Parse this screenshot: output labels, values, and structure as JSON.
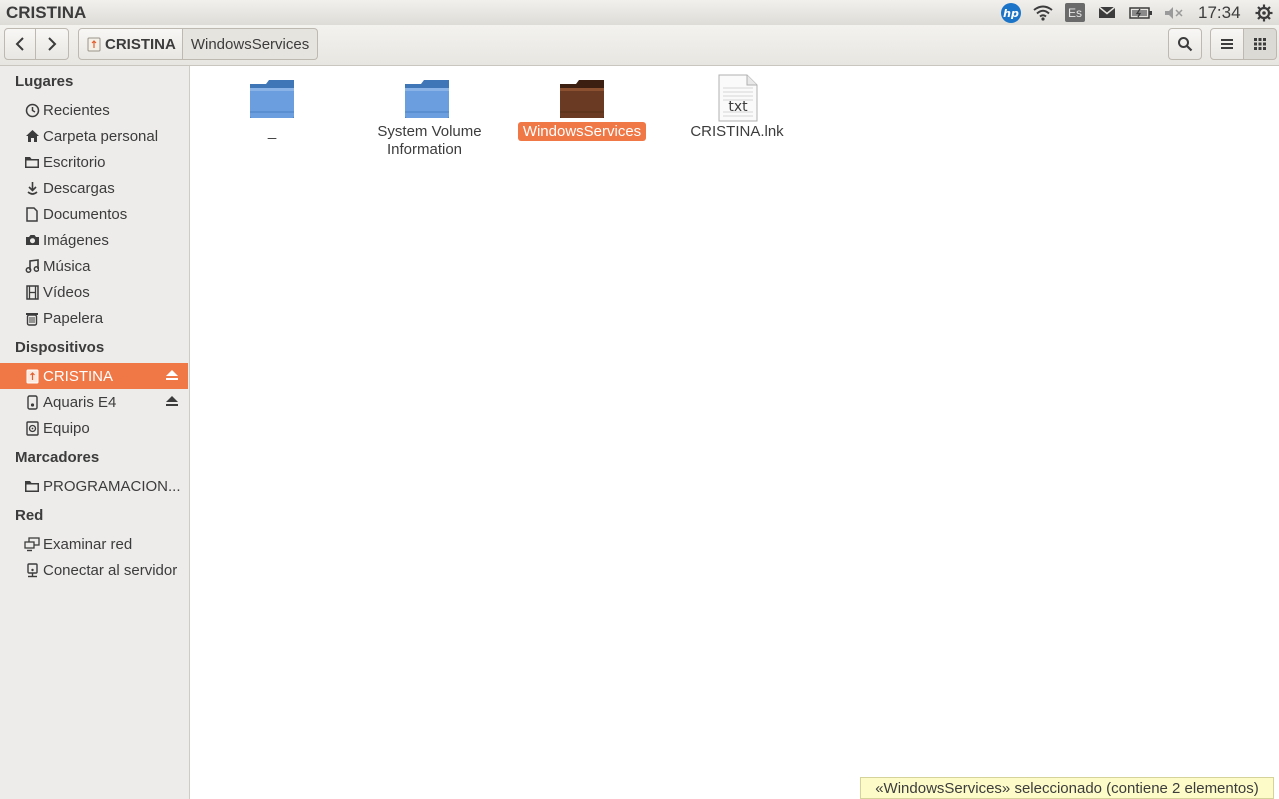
{
  "panel": {
    "app_title": "CRISTINA",
    "keyboard_layout": "Es",
    "clock": "17:34",
    "indicators": [
      "hp-icon",
      "wifi-icon",
      "keyboard-layout",
      "mail-icon",
      "battery-icon",
      "volume-muted-icon",
      "gear-icon"
    ]
  },
  "toolbar": {
    "path": [
      {
        "label": "CRISTINA",
        "icon": "usb-drive-icon"
      },
      {
        "label": "WindowsServices"
      }
    ]
  },
  "sidebar": {
    "sections": [
      {
        "heading": "Lugares",
        "items": [
          {
            "label": "Recientes",
            "icon": "clock-icon"
          },
          {
            "label": "Carpeta personal",
            "icon": "home-icon"
          },
          {
            "label": "Escritorio",
            "icon": "folder-icon"
          },
          {
            "label": "Descargas",
            "icon": "download-icon"
          },
          {
            "label": "Documentos",
            "icon": "document-icon"
          },
          {
            "label": "Imágenes",
            "icon": "camera-icon"
          },
          {
            "label": "Música",
            "icon": "music-icon"
          },
          {
            "label": "Vídeos",
            "icon": "film-icon"
          },
          {
            "label": "Papelera",
            "icon": "trash-icon"
          }
        ]
      },
      {
        "heading": "Dispositivos",
        "items": [
          {
            "label": "CRISTINA",
            "icon": "usb-drive-icon",
            "selected": true,
            "eject": true
          },
          {
            "label": "Aquaris E4",
            "icon": "phone-icon",
            "eject": true
          },
          {
            "label": "Equipo",
            "icon": "computer-icon"
          }
        ]
      },
      {
        "heading": "Marcadores",
        "items": [
          {
            "label": "PROGRAMACION...",
            "icon": "folder-icon"
          }
        ]
      },
      {
        "heading": "Red",
        "items": [
          {
            "label": "Examinar red",
            "icon": "network-icon"
          },
          {
            "label": "Conectar al servidor",
            "icon": "server-icon"
          }
        ]
      }
    ]
  },
  "files": [
    {
      "name": "_",
      "type": "folder",
      "color": "#5a93d5"
    },
    {
      "name": "System Volume Information",
      "type": "folder",
      "color": "#5a93d5"
    },
    {
      "name": "WindowsServices",
      "type": "folder",
      "color": "#6b3a22",
      "selected": true
    },
    {
      "name": "CRISTINA.lnk",
      "type": "text-file",
      "badge": "txt"
    }
  ],
  "status": "«WindowsServices» seleccionado  (contiene 2 elementos)",
  "colors": {
    "accent": "#f07746",
    "folder": "#5a93d5",
    "selected_folder": "#6b3a22",
    "status_bg": "#fdfcc9"
  }
}
